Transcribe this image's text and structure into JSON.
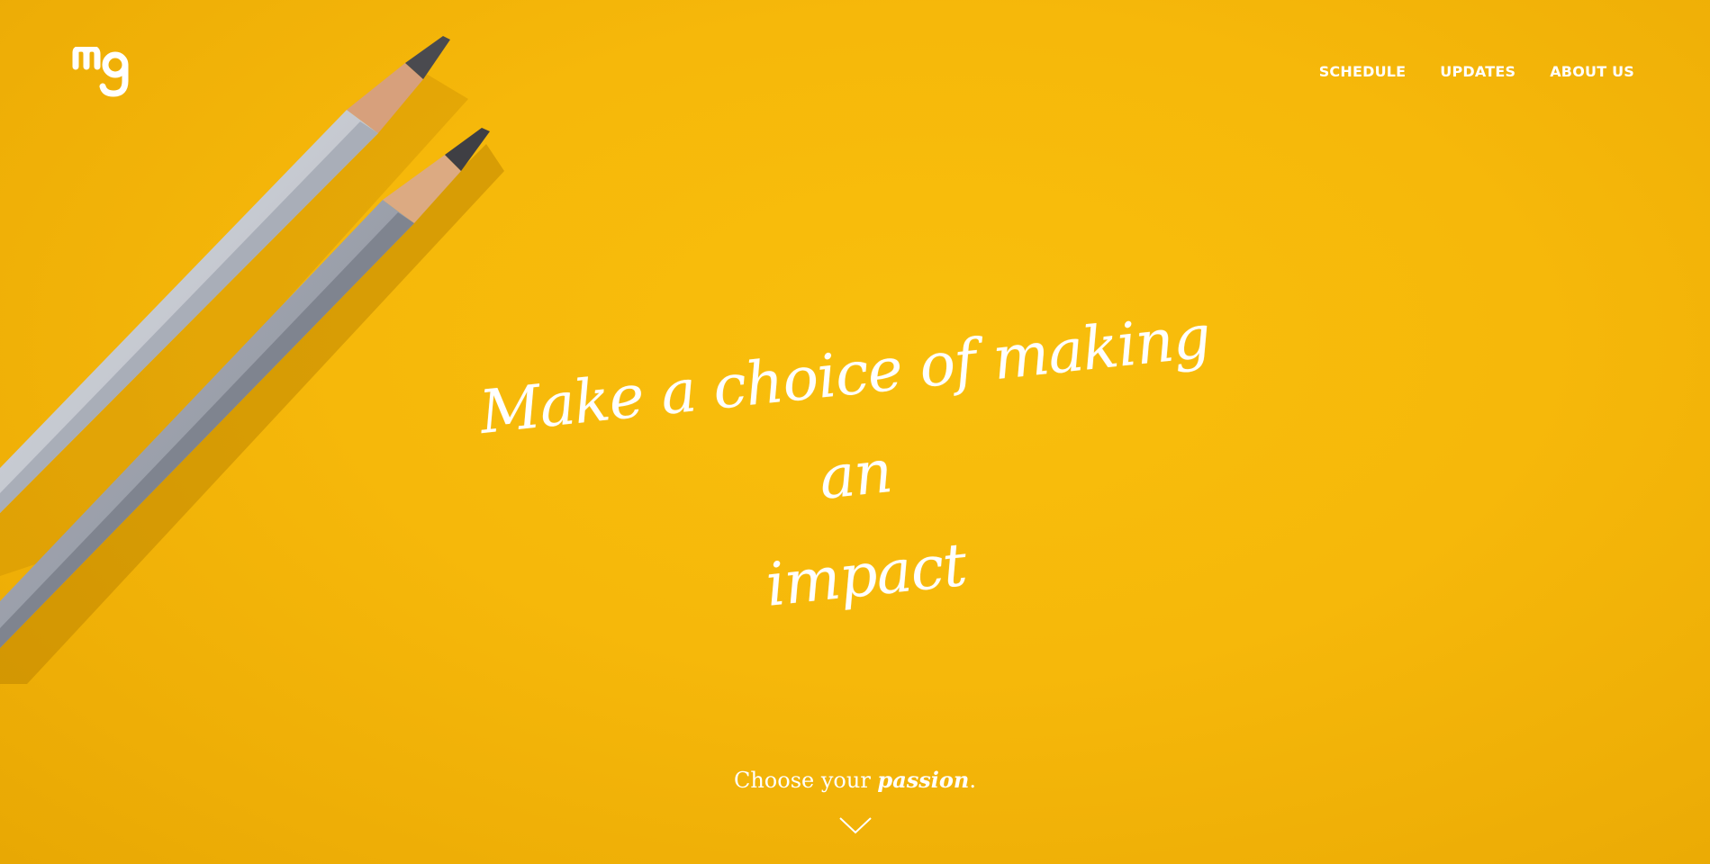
{
  "nav": {
    "items": [
      {
        "label": "SCHEDULE"
      },
      {
        "label": "UPDATES"
      },
      {
        "label": "ABOUT US"
      }
    ]
  },
  "logo": {
    "text": "mg"
  },
  "hero": {
    "headline_line1": "Make a choice of making an",
    "headline_line2": "impact",
    "tagline_prefix": "Choose your ",
    "tagline_emphasis": "passion",
    "tagline_suffix": "."
  },
  "colors": {
    "background": "#f6b80a",
    "text": "#ffffff",
    "pencil_light": "#c9ccd3",
    "pencil_dark": "#9ba0ab",
    "pencil_wood": "#d9a47e"
  },
  "icons": {
    "logo": "mg-logo-icon",
    "scroll": "chevron-down-icon"
  }
}
